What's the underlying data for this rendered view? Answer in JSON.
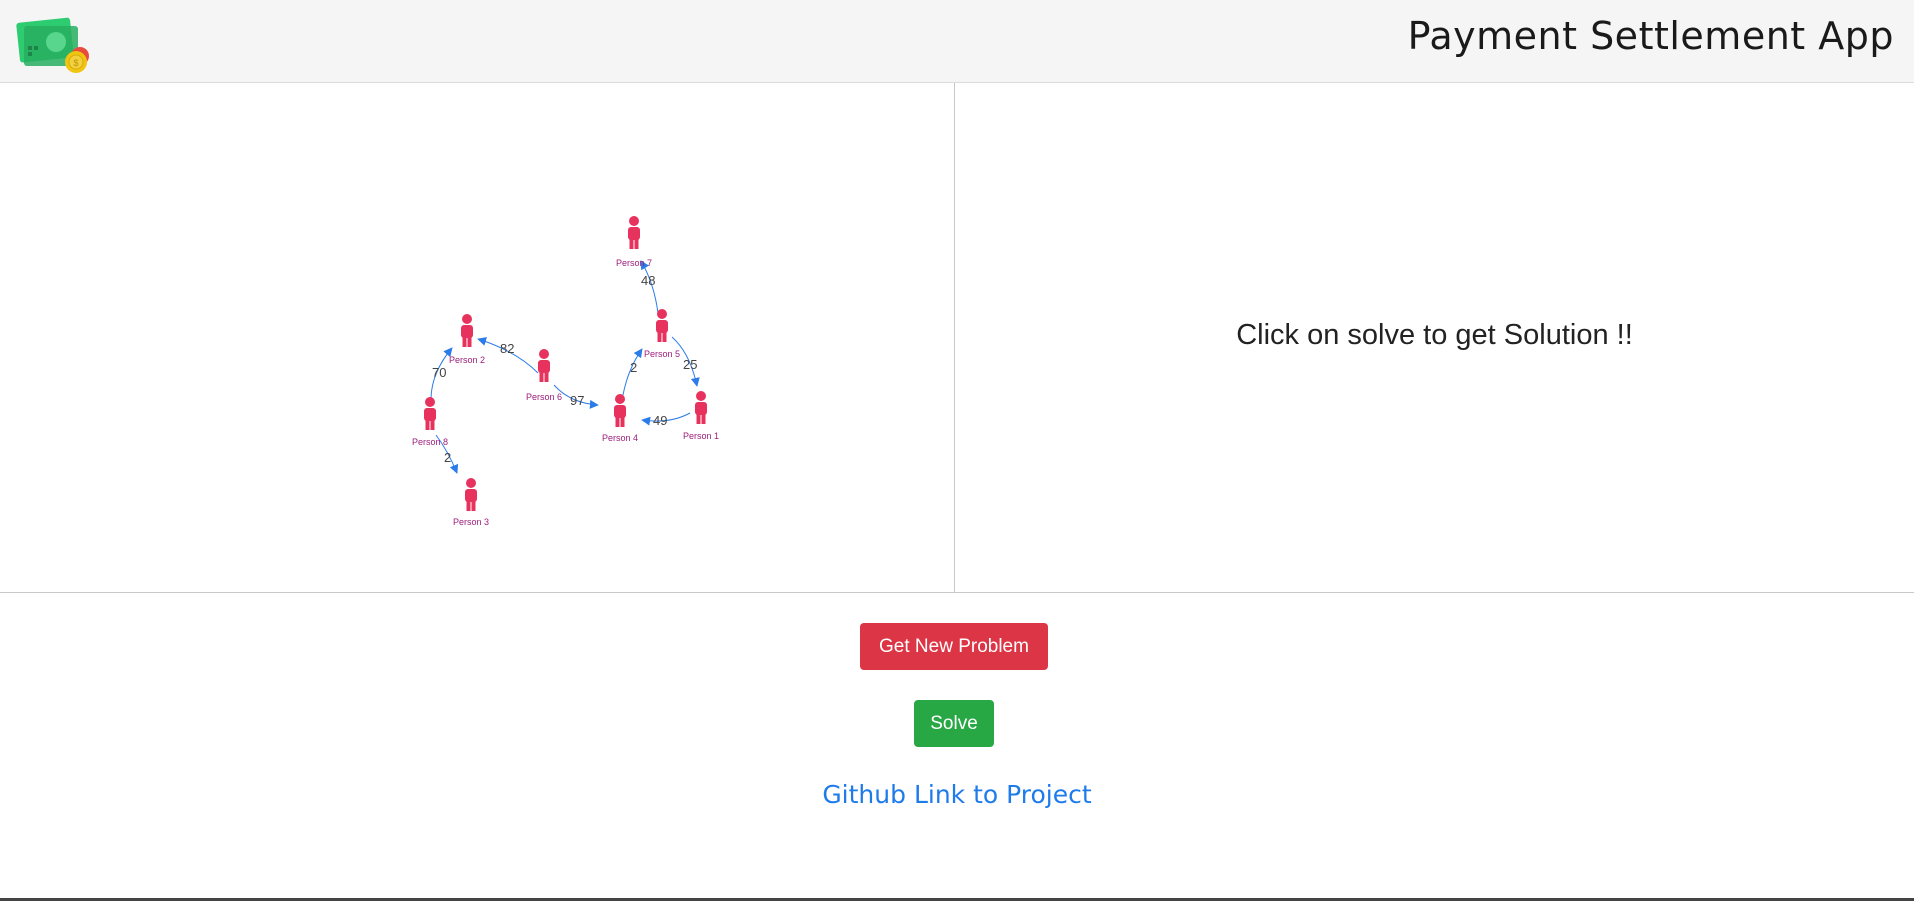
{
  "header": {
    "title": "Payment Settlement App",
    "logo_icon": "money-cash-icon"
  },
  "solution_panel": {
    "message": "Click on solve to get Solution !!"
  },
  "graph": {
    "nodes": [
      {
        "id": "p1",
        "label": "Person 1"
      },
      {
        "id": "p2",
        "label": "Person 2"
      },
      {
        "id": "p3",
        "label": "Person 3"
      },
      {
        "id": "p4",
        "label": "Person 4"
      },
      {
        "id": "p5",
        "label": "Person 5"
      },
      {
        "id": "p6",
        "label": "Person 6"
      },
      {
        "id": "p7",
        "label": "Person 7"
      },
      {
        "id": "p8",
        "label": "Person 8"
      }
    ],
    "edges": [
      {
        "from": "p5",
        "to": "p7",
        "amount": "48"
      },
      {
        "from": "p6",
        "to": "p2",
        "amount": "82"
      },
      {
        "from": "p8",
        "to": "p2",
        "amount": "70"
      },
      {
        "from": "p6",
        "to": "p4",
        "amount": "97"
      },
      {
        "from": "p4",
        "to": "p5",
        "amount": "2"
      },
      {
        "from": "p5",
        "to": "p1",
        "amount": "25"
      },
      {
        "from": "p1",
        "to": "p4",
        "amount": "49"
      },
      {
        "from": "p8",
        "to": "p3",
        "amount": "2"
      }
    ],
    "node_color": "#e8325e",
    "edge_color": "#2b7ce9"
  },
  "actions": {
    "new_problem_label": "Get New Problem",
    "solve_label": "Solve",
    "github_label": "Github Link to Project"
  },
  "colors": {
    "danger": "#dc3545",
    "success": "#28a745",
    "link": "#1e7bea"
  }
}
